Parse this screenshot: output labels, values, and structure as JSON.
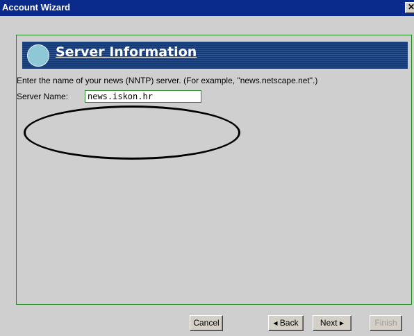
{
  "window": {
    "title": "Account Wizard",
    "close_glyph": "✕"
  },
  "page": {
    "title": "Server Information",
    "description": "Enter the name of your news (NNTP) server. (For example, \"news.netscape.net\".)",
    "server_label": "Server Name:",
    "server_value": "news.iskon.hr"
  },
  "buttons": {
    "cancel": "Cancel",
    "back": "Back",
    "next": "Next",
    "finish": "Finish",
    "back_arrow": "◀",
    "next_arrow": "▶"
  },
  "colors": {
    "titlebar": "#0a2a8c",
    "banner": "#133a78",
    "banner_circle": "#8ec7d6",
    "frame_border": "#1d8a1d",
    "window_bg": "#cfcfcf"
  }
}
